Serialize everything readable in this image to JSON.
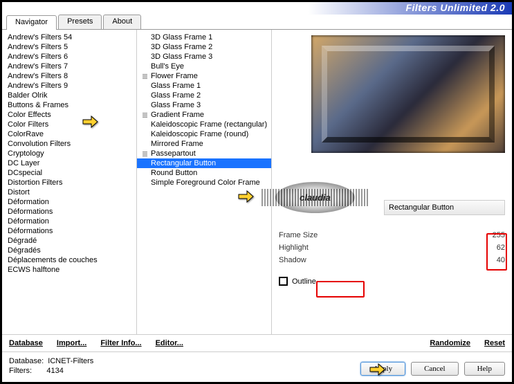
{
  "header": {
    "title": "Filters Unlimited 2.0"
  },
  "tabs": [
    {
      "label": "Navigator",
      "active": true
    },
    {
      "label": "Presets",
      "active": false
    },
    {
      "label": "About",
      "active": false
    }
  ],
  "categories": [
    "Andrew's Filters 54",
    "Andrew's Filters 5",
    "Andrew's Filters 6",
    "Andrew's Filters 7",
    "Andrew's Filters 8",
    "Andrew's Filters 9",
    "Balder Olrik",
    "Buttons & Frames",
    "Color Effects",
    "Color Filters",
    "ColorRave",
    "Convolution Filters",
    "Cryptology",
    "DC Layer",
    "DCspecial",
    "Distortion Filters",
    "Distort",
    "Déformation",
    "Déformations",
    "Déformation",
    "Déformations",
    "Dégradé",
    "Dégradés",
    "Déplacements de couches",
    "ECWS halftone"
  ],
  "category_selected": "Buttons & Frames",
  "filters": [
    {
      "label": "3D Glass Frame 1",
      "group": false
    },
    {
      "label": "3D Glass Frame 2",
      "group": false
    },
    {
      "label": "3D Glass Frame 3",
      "group": false
    },
    {
      "label": "Bull's Eye",
      "group": false
    },
    {
      "label": "Flower Frame",
      "group": true
    },
    {
      "label": "Glass Frame 1",
      "group": false
    },
    {
      "label": "Glass Frame 2",
      "group": false
    },
    {
      "label": "Glass Frame 3",
      "group": false
    },
    {
      "label": "Gradient Frame",
      "group": true
    },
    {
      "label": "Kaleidoscopic Frame (rectangular)",
      "group": false
    },
    {
      "label": "Kaleidoscopic Frame (round)",
      "group": false
    },
    {
      "label": "Mirrored Frame",
      "group": false
    },
    {
      "label": "Passepartout",
      "group": true
    },
    {
      "label": "Rectangular Button",
      "group": false,
      "selected": true
    },
    {
      "label": "Round Button",
      "group": false
    },
    {
      "label": "Simple Foreground Color Frame",
      "group": false
    }
  ],
  "watermark": "claudia",
  "current_filter_name": "Rectangular Button",
  "params": [
    {
      "label": "Frame Size",
      "value": 255
    },
    {
      "label": "Highlight",
      "value": 62
    },
    {
      "label": "Shadow",
      "value": 40
    }
  ],
  "outline": {
    "label": "Outline",
    "checked": false
  },
  "buttons_row": {
    "database": "Database",
    "import": "Import...",
    "filter_info": "Filter Info...",
    "editor": "Editor...",
    "randomize": "Randomize",
    "reset": "Reset"
  },
  "footer_info": {
    "db_label": "Database:",
    "db_value": "ICNET-Filters",
    "filters_label": "Filters:",
    "filters_value": "4134"
  },
  "footer_buttons": {
    "apply": "Apply",
    "cancel": "Cancel",
    "help": "Help"
  }
}
